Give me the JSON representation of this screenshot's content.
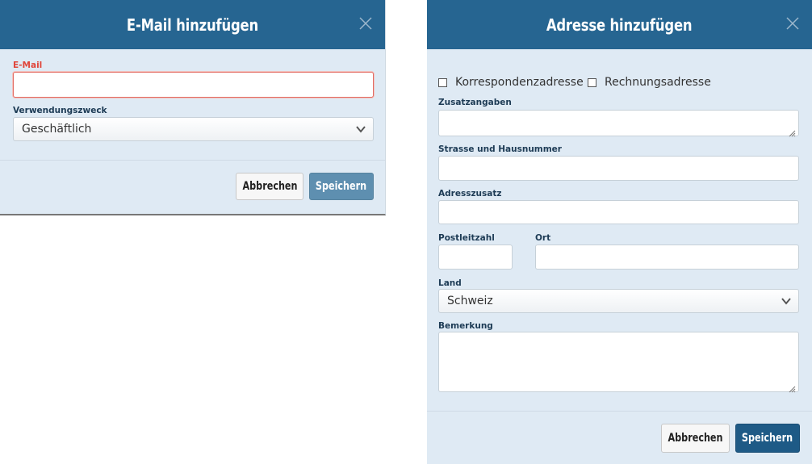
{
  "email_dialog": {
    "title": "E-Mail hinzufügen",
    "email_label": "E-Mail",
    "email_value": "",
    "purpose_label": "Verwendungszweck",
    "purpose_value": "Geschäftlich",
    "cancel_label": "Abbrechen",
    "save_label": "Speichern"
  },
  "address_dialog": {
    "title": "Adresse hinzufügen",
    "correspondence_label": "Korrespondenzadresse",
    "correspondence_checked": false,
    "billing_label": "Rechnungsadresse",
    "billing_checked": false,
    "extra_info_label": "Zusatzangaben",
    "street_label": "Strasse und Hausnummer",
    "address_suffix_label": "Adresszusatz",
    "postal_code_label": "Postleitzahl",
    "city_label": "Ort",
    "country_label": "Land",
    "country_value": "Schweiz",
    "remark_label": "Bemerkung",
    "cancel_label": "Abbrechen",
    "save_label": "Speichern"
  },
  "colors": {
    "header": "#266591",
    "dialog_background": "#dfeaf4",
    "save_button": "#1e5a86",
    "error": "#e0453a"
  }
}
